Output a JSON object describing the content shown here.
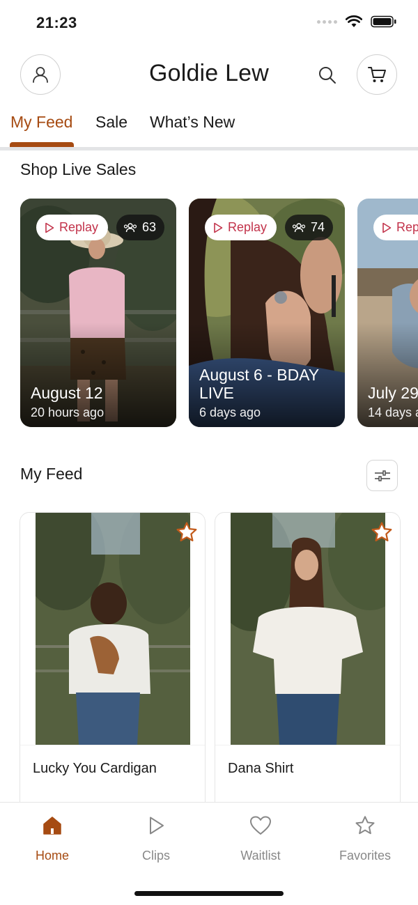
{
  "status_bar": {
    "time": "21:23"
  },
  "header": {
    "title": "Goldie Lew",
    "account_icon": "person-icon",
    "search_icon": "search-icon",
    "cart_icon": "cart-icon"
  },
  "tabs": [
    {
      "label": "My Feed",
      "active": true
    },
    {
      "label": "Sale",
      "active": false
    },
    {
      "label": "What’s New",
      "active": false
    }
  ],
  "live_sales": {
    "title": "Shop Live Sales",
    "cards": [
      {
        "replay_label": "Replay",
        "viewers": "63",
        "name": "August 12",
        "ago": "20 hours ago"
      },
      {
        "replay_label": "Replay",
        "viewers": "74",
        "name": "August 6 - BDAY LIVE",
        "ago": "6 days ago"
      },
      {
        "replay_label": "Rep",
        "viewers": "",
        "name": "July 29",
        "ago": "14 days a"
      }
    ]
  },
  "feed": {
    "title": "My Feed",
    "filter_icon": "sliders-icon",
    "products": [
      {
        "name": "Lucky You Cardigan"
      },
      {
        "name": "Dana Shirt"
      }
    ]
  },
  "bottom_nav": [
    {
      "label": "Home",
      "icon": "home-icon",
      "active": true
    },
    {
      "label": "Clips",
      "icon": "play-icon",
      "active": false
    },
    {
      "label": "Waitlist",
      "icon": "heart-icon",
      "active": false
    },
    {
      "label": "Favorites",
      "icon": "star-icon",
      "active": false
    }
  ],
  "colors": {
    "accent": "#a64b12",
    "replay_text": "#c2324a",
    "favorite_star": "#c25a1a",
    "inactive_nav": "#888888",
    "divider": "#e3e4e6"
  }
}
